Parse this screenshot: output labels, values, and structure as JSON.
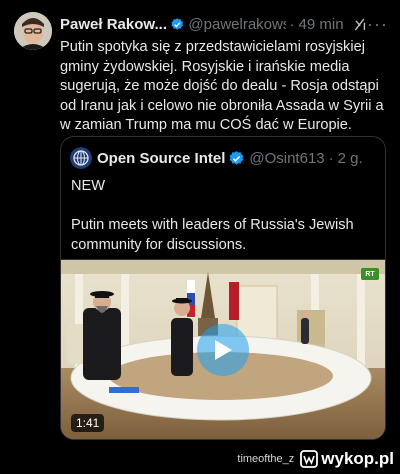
{
  "tweet": {
    "author_name": "Paweł Rakow...",
    "handle": "@pawelrakows...",
    "separator": "·",
    "time": "49 min",
    "more_label": "···",
    "text": "Putin spotyka się z przedstawicielami rosyjskiej gminy żydowskiej. Rosyjskie i irańskie media sugerują, że może dojść do dealu - Rosja odstąpi od Iranu jak i celowo nie obroniła Assada w Syrii a w zamian Trump ma mu COŚ dać w Europie."
  },
  "quote": {
    "author_name": "Open Source Intel",
    "handle": "@Osint613",
    "separator": "·",
    "time": "2 g.",
    "line1": "NEW",
    "line2": "Putin meets with leaders of Russia's Jewish community for discussions."
  },
  "video": {
    "duration": "1:41",
    "channel_badge": "RT"
  },
  "watermark": {
    "user": "timeofthe_z",
    "site": "wykop.pl"
  },
  "colors": {
    "background": "#000000",
    "text": "#e7e9ea",
    "muted": "#71767b",
    "border": "#2f3336",
    "verified": "#1d9bf0"
  },
  "icons": {
    "verified": "verified-badge-icon",
    "grok": "grok-icon",
    "play": "play-icon",
    "wykop": "wykop-logo-icon"
  }
}
